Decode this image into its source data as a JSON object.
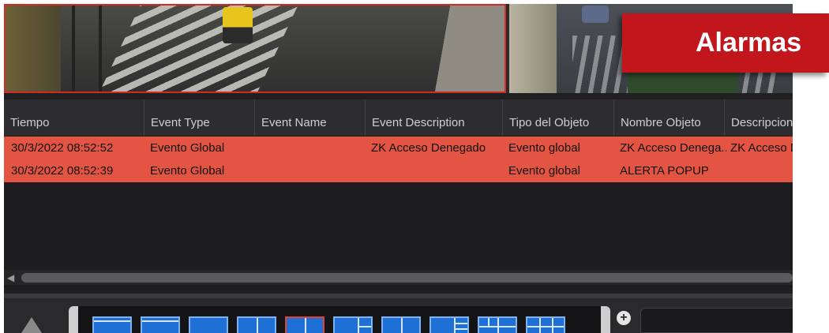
{
  "banner": {
    "title": "Alarmas"
  },
  "grid": {
    "columns": [
      "Tiempo",
      "Event Type",
      "Event Name",
      "Event Description",
      "Tipo del Objeto",
      "Nombre Objeto",
      "Descripcion d"
    ],
    "rows": [
      {
        "tiempo": "30/3/2022 08:52:52",
        "event_type": "Evento Global",
        "event_name": "",
        "event_description": "ZK Acceso Denegado",
        "tipo_objeto": "Evento global",
        "nombre_objeto": "ZK Acceso Denega...",
        "descripcion": "ZK Acceso De"
      },
      {
        "tiempo": "30/3/2022 08:52:39",
        "event_type": "Evento Global",
        "event_name": "",
        "event_description": "",
        "tipo_objeto": "Evento global",
        "nombre_objeto": "ALERTA POPUP",
        "descripcion": ""
      }
    ],
    "row_color": "#e35442"
  },
  "colors": {
    "alarm_banner": "#c0161c",
    "selected_camera_border": "#d42a22",
    "layout_tile": "#1e6fd6"
  },
  "toolbar": {
    "collapse_icon": "triangle-up-icon",
    "add_icon": "plus-circle-icon",
    "add_label": "+"
  }
}
